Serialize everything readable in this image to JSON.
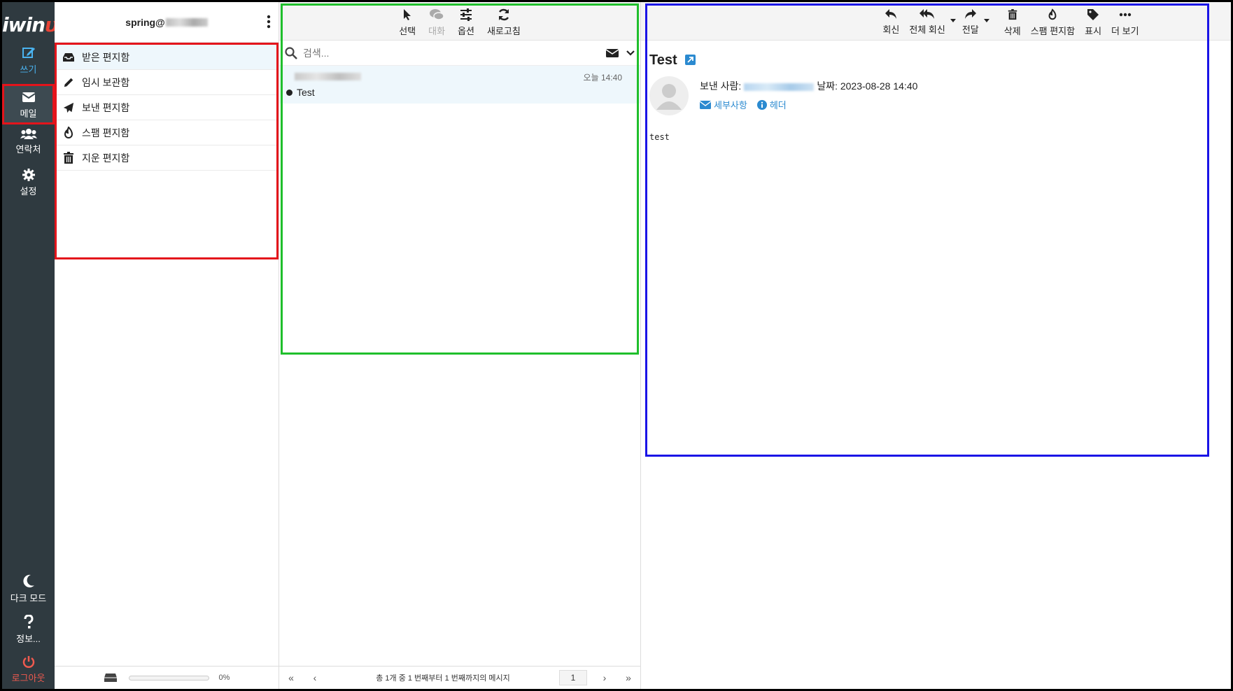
{
  "nav": {
    "logo_text": "iwin",
    "logo_accent": "υ",
    "compose": "쓰기",
    "mail": "메일",
    "contacts": "연락처",
    "settings": "설정",
    "dark_mode": "다크 모드",
    "about": "정보...",
    "logout": "로그아웃"
  },
  "account": {
    "prefix": "spring@"
  },
  "folders": [
    {
      "label": "받은 편지함",
      "icon": "inbox-icon"
    },
    {
      "label": "임시 보관함",
      "icon": "pencil-icon"
    },
    {
      "label": "보낸 편지함",
      "icon": "paper-plane-icon"
    },
    {
      "label": "스팸 편지함",
      "icon": "fire-icon"
    },
    {
      "label": "지운 편지함",
      "icon": "trash-icon"
    }
  ],
  "quota": {
    "percent_label": "0%",
    "fraction": 0
  },
  "list_toolbar": {
    "select": "선택",
    "threads": "대화",
    "options": "옵션",
    "refresh": "새로고침"
  },
  "search": {
    "placeholder": "검색..."
  },
  "messages": [
    {
      "date": "오늘 14:40",
      "subject": "Test",
      "unread": true
    }
  ],
  "pagination": {
    "summary": "총 1개 중 1 번째부터 1 번째까지의 메시지",
    "page": "1"
  },
  "preview_toolbar": {
    "reply": "회신",
    "reply_all": "전체 회신",
    "forward": "전달",
    "delete": "삭제",
    "spam": "스팸 편지함",
    "mark": "표시",
    "more": "더 보기"
  },
  "message": {
    "subject": "Test",
    "from_label": "보낸 사람:",
    "date_label": "날짜:",
    "date": "2023-08-28 14:40",
    "details": "세부사항",
    "headers": "헤더",
    "body": "test"
  },
  "colors": {
    "nav_bg": "#2f3a40",
    "accent": "#2b8ad0",
    "highlight_red": "#e4141b",
    "highlight_green": "#1fbf2c",
    "highlight_blue": "#1a14e6"
  }
}
